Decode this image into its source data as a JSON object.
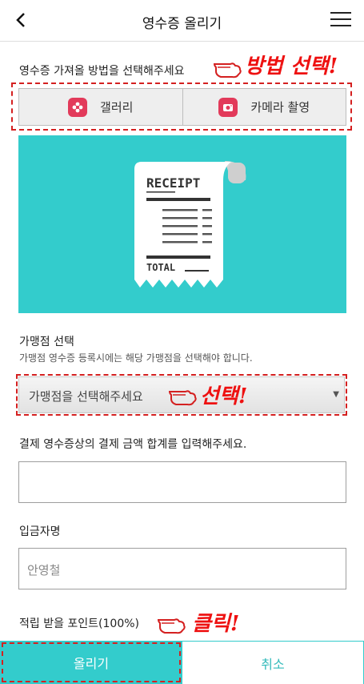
{
  "header": {
    "title": "영수증 올리기"
  },
  "method": {
    "label": "영수증 가져올 방법을 선택해주세요",
    "annotation": "방법 선택!",
    "options": [
      {
        "label": "갤러리",
        "icon": "flower-icon"
      },
      {
        "label": "카메라 촬영",
        "icon": "camera-icon"
      }
    ]
  },
  "receipt_illustration": {
    "heading": "RECEIPT",
    "total": "TOTAL"
  },
  "store": {
    "label": "가맹점 선택",
    "description": "가맹점 영수증 등록시에는 해당 가맹점을 선택해야 합니다.",
    "placeholder": "가맹점을 선택해주세요",
    "annotation": "선택!"
  },
  "amount": {
    "label": "결제 영수증상의 결제 금액 합계를 입력해주세요.",
    "value": ""
  },
  "depositor": {
    "label": "입금자명",
    "value": "안영철"
  },
  "points": {
    "label": "적립 받을 포인트(100%)",
    "annotation": "클릭!"
  },
  "footer": {
    "submit_label": "올리기",
    "cancel_label": "취소"
  },
  "colors": {
    "accent": "#33cccc",
    "annotation": "#d42020",
    "icon_bg": "#e23a5a"
  }
}
